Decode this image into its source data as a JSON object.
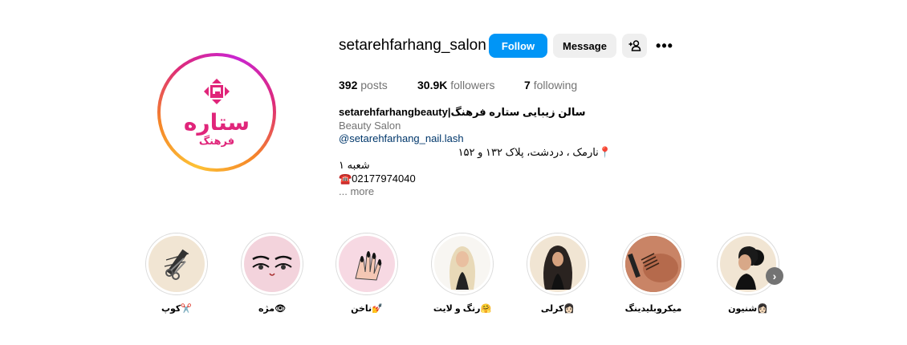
{
  "profile": {
    "username": "setarehfarhang_salon",
    "avatar_icon": "salon-logo-icon",
    "avatar_logo_text": "ستاره",
    "avatar_logo_sub": "فرهنگ",
    "brand_pink": "#e0257a"
  },
  "actions": {
    "follow_label": "Follow",
    "message_label": "Message",
    "add_user_icon": "add-user-icon",
    "more_label": "•••"
  },
  "stats": {
    "posts_count": "392",
    "posts_label": "posts",
    "followers_count": "30.9K",
    "followers_label": "followers",
    "following_count": "7",
    "following_label": "following"
  },
  "bio": {
    "name": "سالن زیبایی ستاره فرهنگ|setarehfarhangbeauty",
    "category": "Beauty Salon",
    "mention": "@setarehfarhang_nail.lash",
    "address": "📍نارمک ، دردشت، پلاک ۱۳۲ و ۱۵۲",
    "branch": "شعبه ۱",
    "phone": "☎️02177974040",
    "more": "... more"
  },
  "highlights": [
    {
      "label": "کوپ✂️",
      "icon": "scissors-comb-icon"
    },
    {
      "label": "مژه👁",
      "icon": "eyelash-icon"
    },
    {
      "label": "ناخن💅",
      "icon": "nail-hand-icon"
    },
    {
      "label": "رنگ و لایت🤗",
      "icon": "blonde-hair-icon"
    },
    {
      "label": "کرلی👩🏻",
      "icon": "curly-hair-icon"
    },
    {
      "label": "میکروبلیدینگ",
      "icon": "microblading-icon"
    },
    {
      "label": "شنیون👩🏻",
      "icon": "updo-hair-icon"
    }
  ],
  "colors": {
    "follow_blue": "#0095f6",
    "button_gray": "#efefef",
    "muted_text": "#737373",
    "link_blue": "#00376b"
  }
}
